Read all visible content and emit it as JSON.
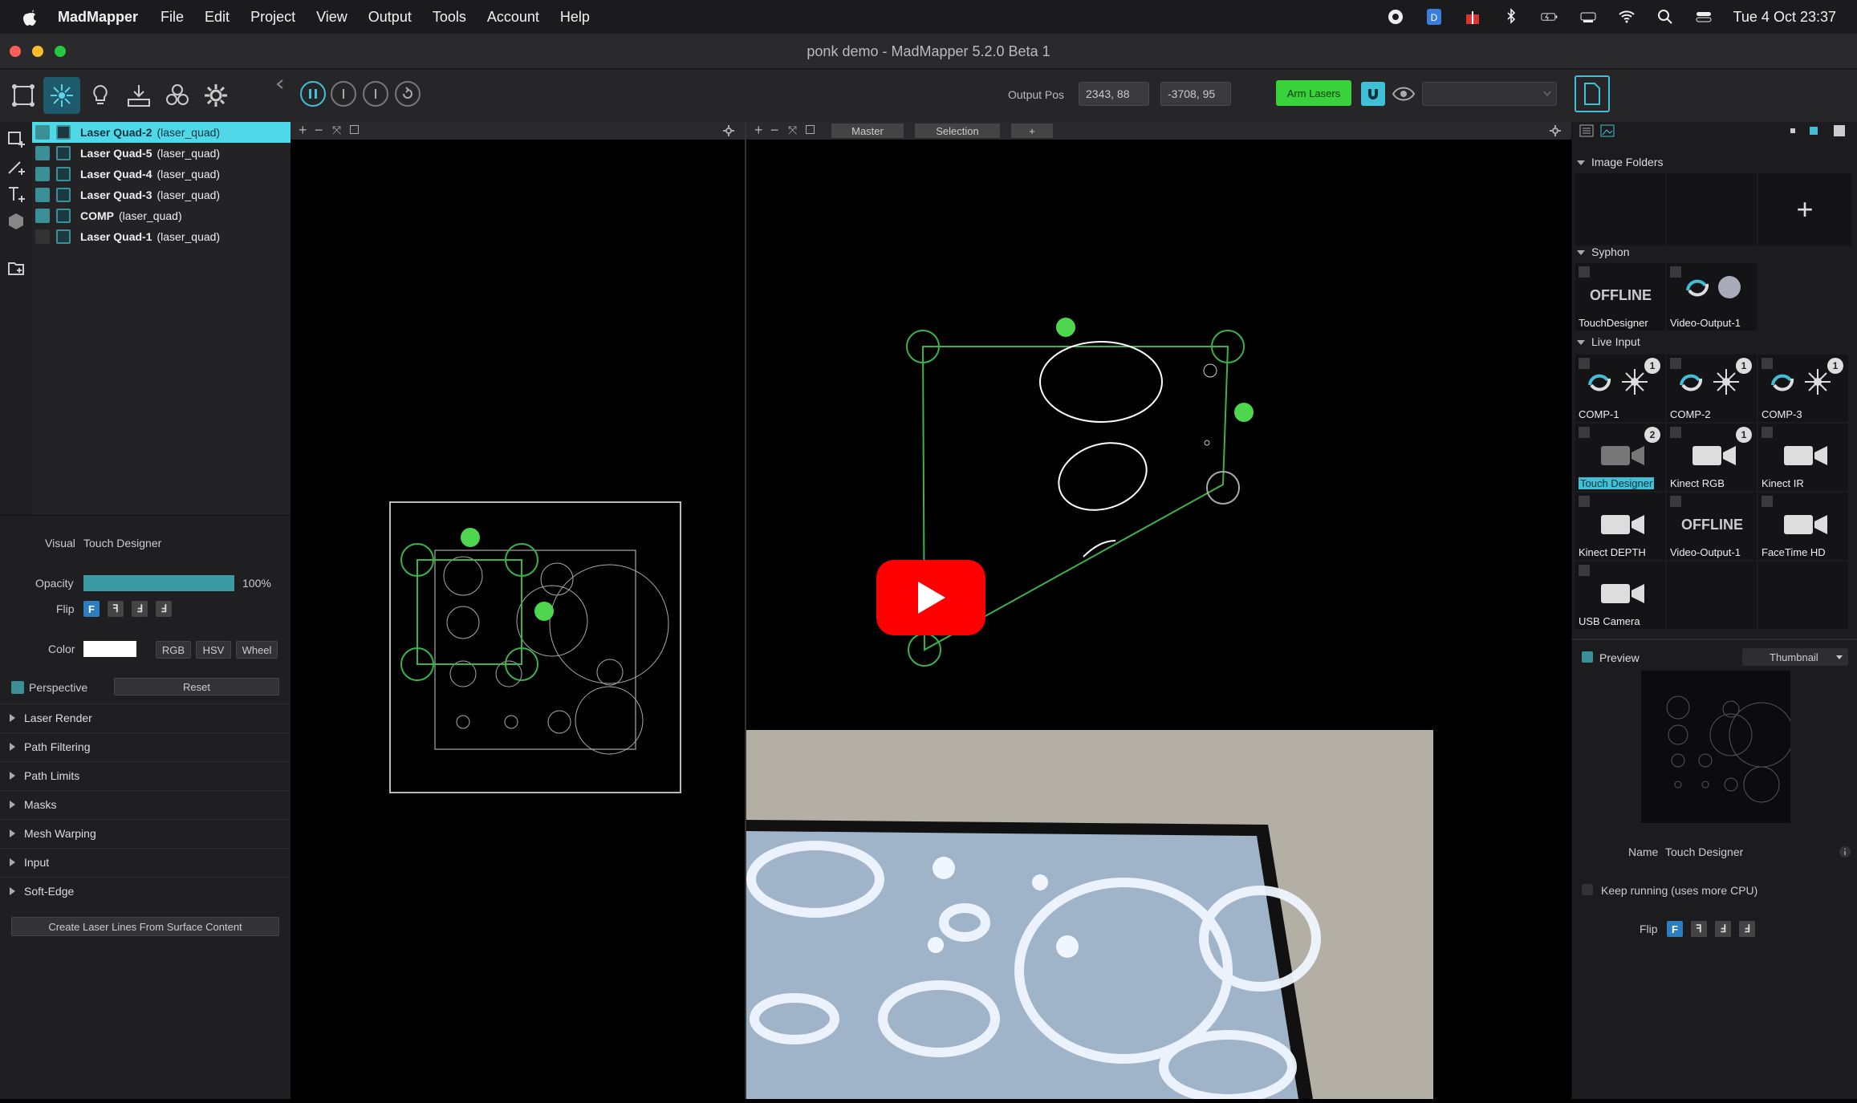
{
  "menubar": {
    "app_name": "MadMapper",
    "menus": [
      "File",
      "Edit",
      "Project",
      "View",
      "Output",
      "Tools",
      "Account",
      "Help"
    ],
    "clock": "Tue 4 Oct  23:37"
  },
  "window": {
    "title": "ponk demo - MadMapper 5.2.0 Beta 1"
  },
  "toolbar": {
    "output_pos_label": "Output Pos",
    "output_pos_x": "2343, 88",
    "output_pos_y": "-3708, 95",
    "arm_lasers": "Arm Lasers"
  },
  "layers": [
    {
      "name": "Laser Quad-2",
      "type": "(laser_quad)",
      "selected": true,
      "visible": true
    },
    {
      "name": "Laser Quad-5",
      "type": "(laser_quad)",
      "selected": false,
      "visible": true
    },
    {
      "name": "Laser Quad-4",
      "type": "(laser_quad)",
      "selected": false,
      "visible": true
    },
    {
      "name": "Laser Quad-3",
      "type": "(laser_quad)",
      "selected": false,
      "visible": true
    },
    {
      "name": "COMP",
      "type": "(laser_quad)",
      "selected": false,
      "visible": true
    },
    {
      "name": "Laser Quad-1",
      "type": "(laser_quad)",
      "selected": false,
      "visible": false
    }
  ],
  "properties": {
    "visual_label": "Visual",
    "visual_value": "Touch Designer",
    "opacity_label": "Opacity",
    "opacity_value": "100%",
    "opacity_fraction": 1.0,
    "flip_label": "Flip",
    "flip_buttons": [
      "F",
      "ꟻ",
      "Ⅎ",
      "ꓞ"
    ],
    "color_label": "Color",
    "color_value": "#ffffff",
    "color_modes": [
      "RGB",
      "HSV",
      "Wheel"
    ],
    "perspective_label": "Perspective",
    "reset_label": "Reset",
    "sections": [
      "Laser Render",
      "Path Filtering",
      "Path Limits",
      "Masks",
      "Mesh Warping",
      "Input",
      "Soft-Edge"
    ],
    "create_button": "Create Laser Lines From Surface Content"
  },
  "view_tabs": {
    "master": "Master",
    "selection": "Selection",
    "add": "+"
  },
  "right_panel": {
    "image_folders": "Image Folders",
    "syphon": "Syphon",
    "syphon_items": [
      {
        "label": "TouchDesigner",
        "offline": "OFFLINE"
      },
      {
        "label": "Video-Output-1"
      }
    ],
    "live_input": "Live Input",
    "live_items": [
      {
        "label": "COMP-1",
        "badge": "1"
      },
      {
        "label": "COMP-2",
        "badge": "1"
      },
      {
        "label": "COMP-3",
        "badge": "1"
      },
      {
        "label": "Touch Designer",
        "badge": "2",
        "highlight": true
      },
      {
        "label": "Kinect RGB",
        "badge": "1"
      },
      {
        "label": "Kinect IR"
      },
      {
        "label": "Kinect DEPTH"
      },
      {
        "label": "Video-Output-1",
        "offline": "OFFLINE"
      },
      {
        "label": "FaceTime HD"
      },
      {
        "label": "USB Camera"
      }
    ],
    "preview_label": "Preview",
    "preview_mode": "Thumbnail",
    "name_label": "Name",
    "name_value": "Touch Designer",
    "keep_running": "Keep running (uses more CPU)",
    "flip_label": "Flip"
  }
}
